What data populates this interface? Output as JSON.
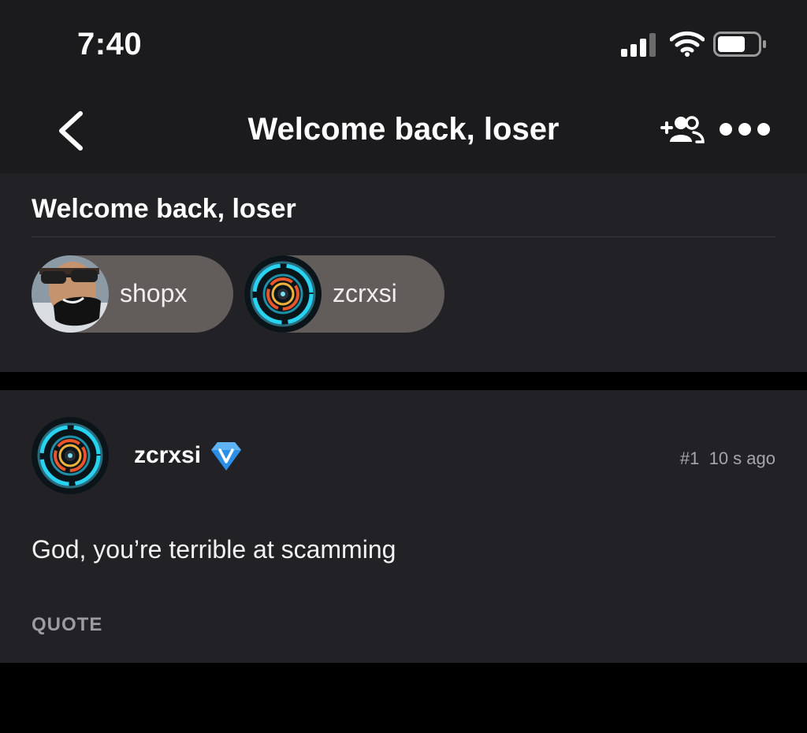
{
  "status_bar": {
    "time": "7:40",
    "icons": [
      "signal-icon",
      "wifi-icon",
      "battery-icon"
    ]
  },
  "nav": {
    "title": "Welcome back, loser",
    "icons": [
      "back-chevron-icon",
      "add-people-icon",
      "more-dots-icon"
    ]
  },
  "group": {
    "title": "Welcome back, loser",
    "members": [
      {
        "name": "shopx",
        "avatar": "photo-avatar"
      },
      {
        "name": "zcrxsi",
        "avatar": "neon-ring-avatar"
      }
    ]
  },
  "post": {
    "username": "zcrxsi",
    "badge_icon": "verified-v-icon",
    "number": "#1",
    "time_ago": "10 s ago",
    "body": "God, you’re terrible at scamming",
    "quote_label": "QUOTE"
  },
  "colors": {
    "background": "#000000",
    "bar": "#1b1b1d",
    "card": "#222126",
    "chip": "#625c5b",
    "verified_badge": "#2b8fe8",
    "muted_text": "#a6a5aa"
  }
}
